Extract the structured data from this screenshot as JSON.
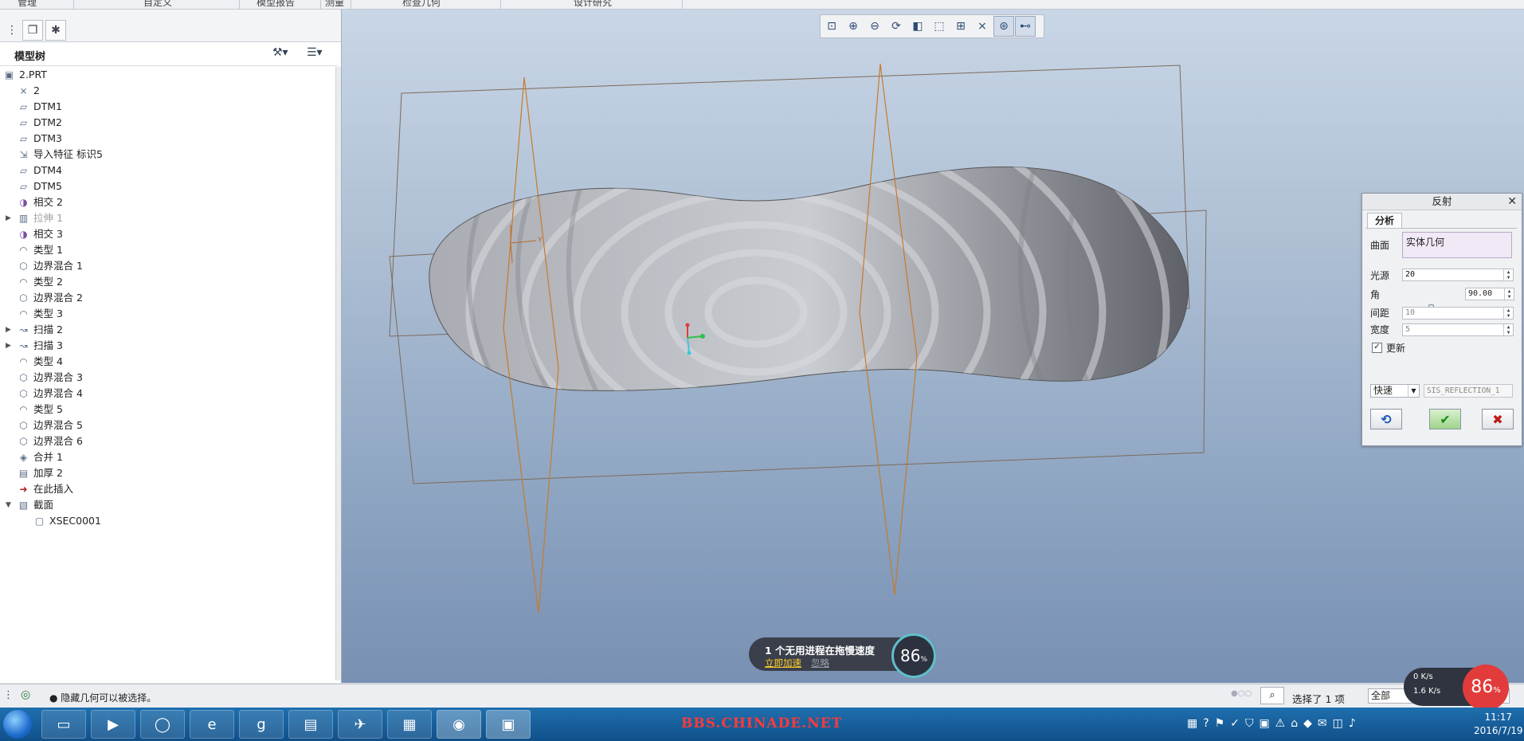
{
  "top_menu": [
    "管理",
    "自定义",
    "模型报告",
    "测量",
    "检查几何",
    "设计研究"
  ],
  "model_tree": {
    "title": "模型树",
    "items": [
      {
        "label": "2.PRT",
        "icon": "part-icon",
        "indent": 0
      },
      {
        "label": "2",
        "icon": "coordinate-system-icon",
        "indent": 1
      },
      {
        "label": "DTM1",
        "icon": "datum-plane-icon",
        "indent": 1
      },
      {
        "label": "DTM2",
        "icon": "datum-plane-icon",
        "indent": 1
      },
      {
        "label": "DTM3",
        "icon": "datum-plane-icon",
        "indent": 1
      },
      {
        "label": "导入特征 标识5",
        "icon": "import-feature-icon",
        "indent": 1
      },
      {
        "label": "DTM4",
        "icon": "datum-plane-icon",
        "indent": 1
      },
      {
        "label": "DTM5",
        "icon": "datum-plane-icon",
        "indent": 1
      },
      {
        "label": "相交 2",
        "icon": "intersect-icon",
        "indent": 1
      },
      {
        "label": "拉伸 1",
        "icon": "extrude-icon",
        "indent": 1,
        "expand": true,
        "dim": true
      },
      {
        "label": "相交 3",
        "icon": "intersect-icon",
        "indent": 1
      },
      {
        "label": "类型 1",
        "icon": "style-icon",
        "indent": 1
      },
      {
        "label": "边界混合 1",
        "icon": "boundary-blend-icon",
        "indent": 1
      },
      {
        "label": "类型 2",
        "icon": "style-icon",
        "indent": 1
      },
      {
        "label": "边界混合 2",
        "icon": "boundary-blend-icon",
        "indent": 1
      },
      {
        "label": "类型 3",
        "icon": "style-icon",
        "indent": 1
      },
      {
        "label": "扫描 2",
        "icon": "sweep-icon",
        "indent": 1,
        "expand": true
      },
      {
        "label": "扫描 3",
        "icon": "sweep-icon",
        "indent": 1,
        "expand": true
      },
      {
        "label": "类型 4",
        "icon": "style-icon",
        "indent": 1
      },
      {
        "label": "边界混合 3",
        "icon": "boundary-blend-icon",
        "indent": 1
      },
      {
        "label": "边界混合 4",
        "icon": "boundary-blend-icon",
        "indent": 1
      },
      {
        "label": "类型 5",
        "icon": "style-icon",
        "indent": 1
      },
      {
        "label": "边界混合 5",
        "icon": "boundary-blend-icon",
        "indent": 1
      },
      {
        "label": "边界混合 6",
        "icon": "boundary-blend-icon",
        "indent": 1
      },
      {
        "label": "合并 1",
        "icon": "merge-icon",
        "indent": 1
      },
      {
        "label": "加厚 2",
        "icon": "thicken-icon",
        "indent": 1
      },
      {
        "label": "在此插入",
        "icon": "insert-here-icon",
        "indent": 1
      },
      {
        "label": "截面",
        "icon": "section-folder-icon",
        "indent": 1,
        "expand": true,
        "open": true
      },
      {
        "label": "XSEC0001",
        "icon": "cross-section-icon",
        "indent": 2
      }
    ]
  },
  "view_toolbar": [
    "zoom-fit-icon",
    "zoom-in-icon",
    "zoom-out-icon",
    "repaint-icon",
    "display-style-icon",
    "saved-views-icon",
    "perspective-icon",
    "datum-display-icon",
    "spin-center-icon",
    "annotation-display-icon"
  ],
  "reflection_dialog": {
    "title": "反射",
    "tab": "分析",
    "surface_label": "曲面",
    "surface_value": "实体几何",
    "light_label": "光源",
    "light_value": "20",
    "angle_label": "角",
    "angle_value": "90.00",
    "angle_fraction": 0.5,
    "spacing_label": "间距",
    "spacing_value": "10",
    "width_label": "宽度",
    "width_value": "5",
    "update_label": "更新",
    "update_checked": true,
    "mode_value": "快速",
    "name_value": "SIS_REFLECTION_1"
  },
  "notice": {
    "text": "1 个无用进程在拖慢速度",
    "accelerate": "立即加速",
    "ignore": "忽略",
    "percent": "86",
    "percent_unit": "%"
  },
  "status": {
    "message": "● 隐藏几何可以被选择。",
    "selection": "选择了 1 项",
    "filter": "全部"
  },
  "net_monitor": {
    "up": "0 K/s",
    "down": "1.6 K/s",
    "percent": "86",
    "percent_unit": "%"
  },
  "taskbar": {
    "watermark": "BBS.CHINADE.NET",
    "time": "11:17",
    "date": "2016/7/19"
  },
  "colors": {
    "viewport_top": "#c8d6e6",
    "viewport_bottom": "#7890b2",
    "datum_orange": "#c77a2c",
    "accent_red": "#e23b3b"
  }
}
